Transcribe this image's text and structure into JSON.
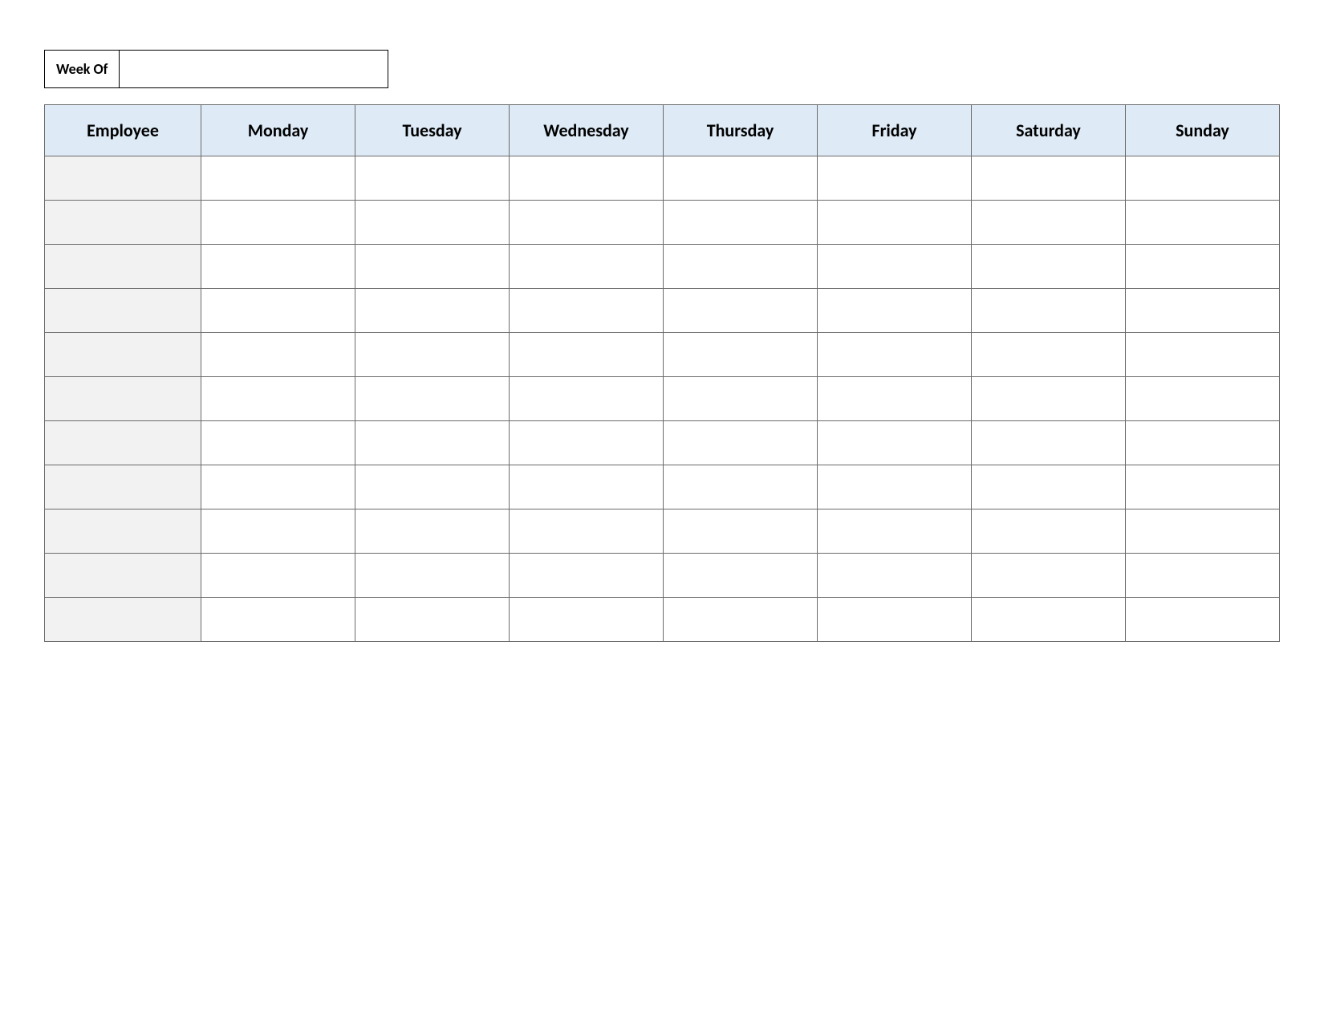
{
  "week_of": {
    "label": "Week Of",
    "value": ""
  },
  "headers": {
    "employee": "Employee",
    "days": [
      "Monday",
      "Tuesday",
      "Wednesday",
      "Thursday",
      "Friday",
      "Saturday",
      "Sunday"
    ]
  },
  "rows": [
    {
      "employee": "",
      "monday": "",
      "tuesday": "",
      "wednesday": "",
      "thursday": "",
      "friday": "",
      "saturday": "",
      "sunday": ""
    },
    {
      "employee": "",
      "monday": "",
      "tuesday": "",
      "wednesday": "",
      "thursday": "",
      "friday": "",
      "saturday": "",
      "sunday": ""
    },
    {
      "employee": "",
      "monday": "",
      "tuesday": "",
      "wednesday": "",
      "thursday": "",
      "friday": "",
      "saturday": "",
      "sunday": ""
    },
    {
      "employee": "",
      "monday": "",
      "tuesday": "",
      "wednesday": "",
      "thursday": "",
      "friday": "",
      "saturday": "",
      "sunday": ""
    },
    {
      "employee": "",
      "monday": "",
      "tuesday": "",
      "wednesday": "",
      "thursday": "",
      "friday": "",
      "saturday": "",
      "sunday": ""
    },
    {
      "employee": "",
      "monday": "",
      "tuesday": "",
      "wednesday": "",
      "thursday": "",
      "friday": "",
      "saturday": "",
      "sunday": ""
    },
    {
      "employee": "",
      "monday": "",
      "tuesday": "",
      "wednesday": "",
      "thursday": "",
      "friday": "",
      "saturday": "",
      "sunday": ""
    },
    {
      "employee": "",
      "monday": "",
      "tuesday": "",
      "wednesday": "",
      "thursday": "",
      "friday": "",
      "saturday": "",
      "sunday": ""
    },
    {
      "employee": "",
      "monday": "",
      "tuesday": "",
      "wednesday": "",
      "thursday": "",
      "friday": "",
      "saturday": "",
      "sunday": ""
    },
    {
      "employee": "",
      "monday": "",
      "tuesday": "",
      "wednesday": "",
      "thursday": "",
      "friday": "",
      "saturday": "",
      "sunday": ""
    },
    {
      "employee": "",
      "monday": "",
      "tuesday": "",
      "wednesday": "",
      "thursday": "",
      "friday": "",
      "saturday": "",
      "sunday": ""
    }
  ]
}
